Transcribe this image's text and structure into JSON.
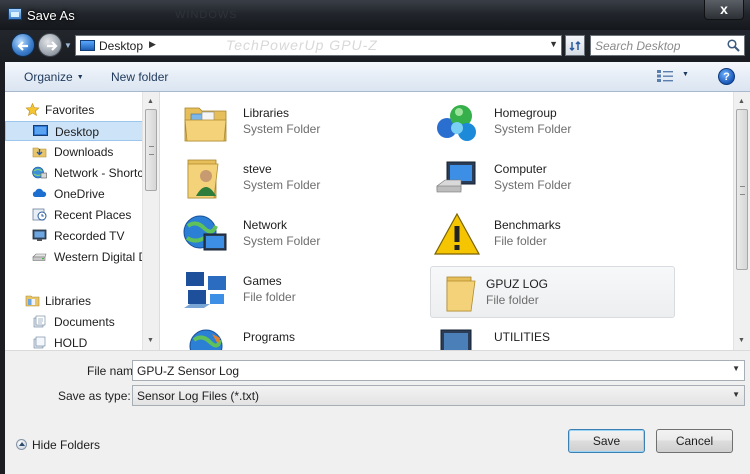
{
  "window": {
    "title": "Save As",
    "ghost_title": "WINDOWS",
    "close_label": "x"
  },
  "address": {
    "crumb": "Desktop",
    "ghost_text": "TechPowerUp GPU-Z"
  },
  "search": {
    "placeholder": "Search Desktop"
  },
  "toolbar": {
    "organize_label": "Organize",
    "new_folder_label": "New folder",
    "help_label": "?"
  },
  "navpane": {
    "items": [
      {
        "label": "Favorites",
        "icon": "star-icon",
        "group": true
      },
      {
        "label": "Desktop",
        "icon": "desktop-icon",
        "selected": true
      },
      {
        "label": "Downloads",
        "icon": "downloads-icon"
      },
      {
        "label": "Network - Shortcu",
        "icon": "network-icon"
      },
      {
        "label": "OneDrive",
        "icon": "cloud-icon"
      },
      {
        "label": "Recent Places",
        "icon": "recent-places-icon"
      },
      {
        "label": "Recorded TV",
        "icon": "tv-icon"
      },
      {
        "label": "Western Digital D",
        "icon": "drive-icon"
      },
      {
        "label": "Libraries",
        "icon": "libraries-icon",
        "group": true
      },
      {
        "label": "Documents",
        "icon": "documents-icon"
      },
      {
        "label": "HOLD",
        "icon": "library-folder-icon"
      }
    ]
  },
  "content": {
    "tiles": [
      {
        "name": "Libraries",
        "type": "System Folder",
        "icon": "libraries-folder-icon"
      },
      {
        "name": "Homegroup",
        "type": "System Folder",
        "icon": "homegroup-icon"
      },
      {
        "name": "steve",
        "type": "System Folder",
        "icon": "user-folder-icon"
      },
      {
        "name": "Computer",
        "type": "System Folder",
        "icon": "computer-icon"
      },
      {
        "name": "Network",
        "type": "System Folder",
        "icon": "network-globe-icon"
      },
      {
        "name": "Benchmarks",
        "type": "File folder",
        "icon": "warning-folder-icon"
      },
      {
        "name": "Games",
        "type": "File folder",
        "icon": "games-icon"
      },
      {
        "name": "GPUZ LOG",
        "type": "File folder",
        "icon": "folder-icon",
        "highlight": true
      },
      {
        "name": "Programs",
        "type": "",
        "icon": "programs-globe-icon"
      },
      {
        "name": "UTILITIES",
        "type": "",
        "icon": "utilities-monitor-icon"
      }
    ]
  },
  "fields": {
    "file_name_label": "File name:",
    "file_name_value": "GPU-Z Sensor Log",
    "save_type_label": "Save as type:",
    "save_type_value": "Sensor Log Files (*.txt)"
  },
  "footer": {
    "hide_folders_label": "Hide Folders",
    "save_label": "Save",
    "cancel_label": "Cancel"
  },
  "colors": {
    "accent": "#3c7fb1",
    "selection": "#cde3f7",
    "toolbar": "#e6edf6"
  }
}
